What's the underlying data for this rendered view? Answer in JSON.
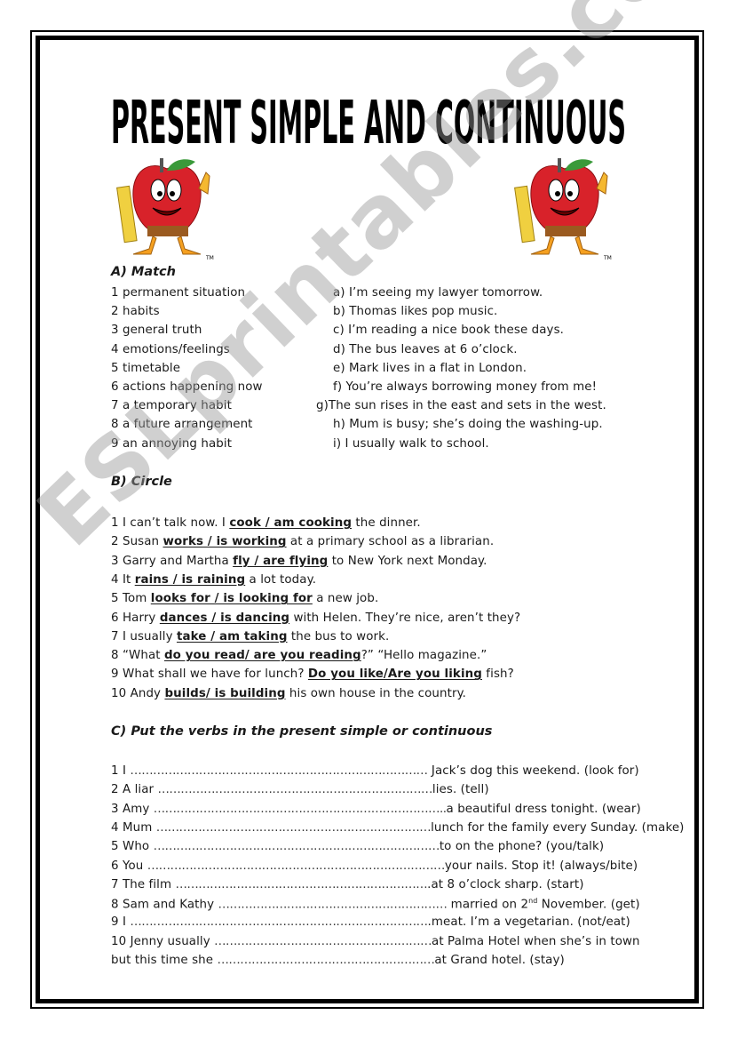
{
  "title": "PRESENT SIMPLE AND CONTINUOUS",
  "watermark": "ESLprintables.com",
  "mascot": {
    "icon": "apple-mascot-icon",
    "tm": "TM"
  },
  "section_a": {
    "heading": "A) Match",
    "left": [
      "1 permanent situation",
      "2 habits",
      "3 general truth",
      "4 emotions/feelings",
      "5 timetable",
      "6 actions happening now",
      "7 a temporary habit",
      "8 a future arrangement",
      "9 an annoying habit"
    ],
    "right": [
      "a) I’m seeing my lawyer tomorrow.",
      "b) Thomas likes pop music.",
      "c) I’m reading a nice book these days.",
      "d) The bus leaves at 6 o’clock.",
      "e) Mark lives in a flat in London.",
      "f) You’re always borrowing money from me!",
      "g)The sun rises in the east and sets in the west.",
      "h) Mum is busy; she’s doing the washing-up.",
      "i) I usually walk to school."
    ]
  },
  "section_b": {
    "heading": "B) Circle",
    "items": [
      {
        "pre": "1 I can’t talk now. I ",
        "options": "cook / am cooking",
        "post": " the dinner."
      },
      {
        "pre": "2 Susan ",
        "options": "works / is working",
        "post": " at a primary school as a librarian."
      },
      {
        "pre": "3 Garry and Martha ",
        "options": "fly / are flying",
        "post": " to New York next Monday."
      },
      {
        "pre": "4 It ",
        "options": "rains / is raining",
        "post": " a lot today."
      },
      {
        "pre": "5 Tom ",
        "options": "looks for / is looking for",
        "post": " a new job."
      },
      {
        "pre": "6 Harry ",
        "options": "dances / is dancing",
        "post": " with Helen. They’re nice, aren’t they?"
      },
      {
        "pre": "7 I usually ",
        "options": "take / am taking",
        "post": " the bus to work."
      },
      {
        "pre": "8 “What ",
        "options": "do you read/ are you reading",
        "post": "?” “Hello magazine.”"
      },
      {
        "pre": "9 What shall we have for lunch? ",
        "options": "Do you like/Are you liking",
        "post": " fish?"
      },
      {
        "pre": "10 Andy ",
        "options": "builds/ is building",
        "post": " his own house in the country."
      }
    ]
  },
  "section_c": {
    "heading": "C) Put the verbs in the present simple or continuous",
    "items": [
      {
        "pre": "1 I ",
        "dots": "……………………………………………………………………",
        "post": " Jack’s dog this weekend. (look for)"
      },
      {
        "pre": "2 A liar ",
        "dots": "………………………………………………………………",
        "post": "lies. (tell)"
      },
      {
        "pre": "3 Amy ",
        "dots": "…………………………………………………………………..",
        "post": "a beautiful dress tonight. (wear)"
      },
      {
        "pre": "4 Mum ",
        "dots": "………………………………………………………………",
        "post": "lunch for the family every Sunday. (make)"
      },
      {
        "pre": "5 Who ",
        "dots": "…………………………………………………………………",
        "post": "to on the phone? (you/talk)"
      },
      {
        "pre": "6 You ",
        "dots": "……………………………………………………………………",
        "post": "your nails. Stop it! (always/bite)"
      },
      {
        "pre": "7 The film ",
        "dots": "…………………………………………………………",
        "post": ".at 8 o’clock sharp. (start)"
      },
      {
        "pre": "8 Sam and Kathy ",
        "dots": "……………………………………………………",
        "post": " married on 2",
        "sup": "nd",
        "post2": " November. (get)"
      },
      {
        "pre": "9 I ",
        "dots": "……………………………………………………………………",
        "post": ".meat. I’m a vegetarian. (not/eat)"
      },
      {
        "pre": "10 Jenny usually ",
        "dots": "…………………………………………………",
        "post": "at Palma Hotel when she’s in town"
      },
      {
        "pre": "but this time she ",
        "dots": "…………………………………………………",
        "post": "at Grand hotel. (stay)"
      }
    ]
  }
}
